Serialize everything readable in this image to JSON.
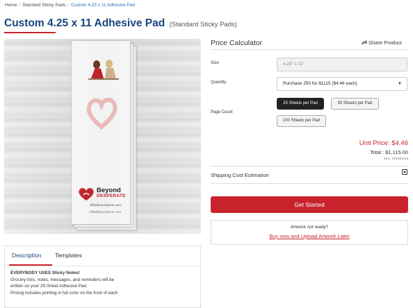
{
  "breadcrumb": {
    "home": "Home",
    "category": "Standard Sticky Pads",
    "current": "Custom 4.25 x 11 Adhesive Pad"
  },
  "product": {
    "title": "Custom 4.25 x 11 Adhesive Pad",
    "subtitle": "(Standard Sticky Pads)",
    "image_alt": "Sticky pad with Beyond Desperate logo",
    "logo_text_1": "Beyond",
    "logo_text_2": "DESPERATE",
    "logo_url": "rllifadbeyondyone.com",
    "pad_url": "rllifadbeyondyone.com"
  },
  "calculator": {
    "title": "Price Calculator",
    "share_label": "Share Product",
    "size_label": "Size",
    "size_value": "4.25\" x 11\"",
    "quantity_label": "Quantity",
    "quantity_value": "Purchase 250 for $1115 ($4.46 each)",
    "page_count_label": "Page Count",
    "page_options": [
      "25 Sheets per Pad",
      "50 Sheets per Pad",
      "100 Sheets per Pad"
    ],
    "selected_page_option": "25 Sheets per Pad",
    "unit_price": "Unit Price: $4.46",
    "total": "Total : $1,115.00",
    "sku": "SKU: SP6251125",
    "shipping_label": "Shipping Cost Estimation",
    "cta_label": "Get Started",
    "artwork_question": "Artwork not ready?",
    "artwork_link": "Buy now and Upload Artwork Later"
  },
  "tabs": {
    "items": [
      "Description",
      "Templates"
    ],
    "active": "Description"
  },
  "description": {
    "heading": "EVERYBODY USES Sticky Notes!",
    "line1": "Grocery lists, notes, messages, and reminders will be",
    "line2": "written on your 25-Sheet Adhesive Pad.",
    "line3": "Pricing includes printing in full color on the front of each"
  },
  "colors": {
    "brand_blue": "#17457e",
    "accent_red": "#c8232c",
    "link_blue": "#2a6ebb"
  }
}
